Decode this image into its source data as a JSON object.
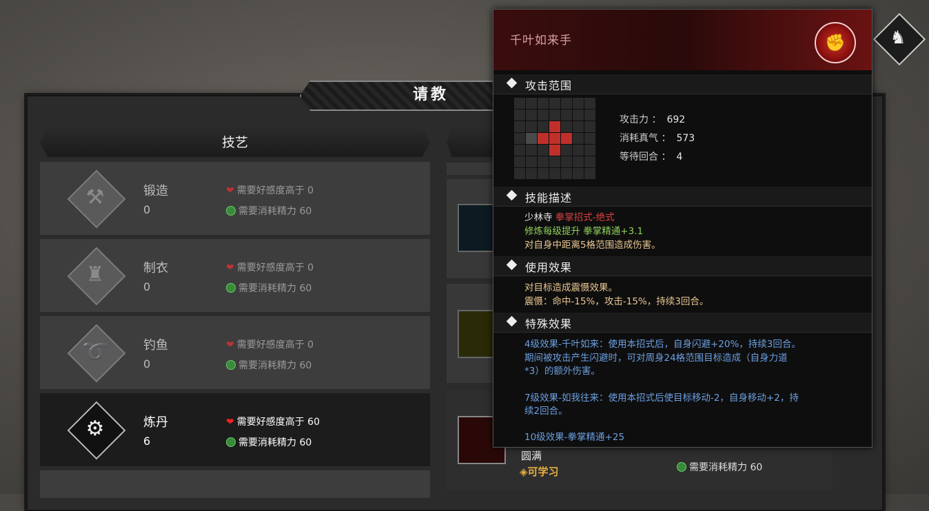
{
  "window": {
    "title": "请教"
  },
  "left_column": {
    "header": "技艺",
    "skills": [
      {
        "name": "锻造",
        "level": "0",
        "req_affinity": "需要好感度高于 0",
        "req_energy": "需要消耗精力 60",
        "icon": "forge-icon",
        "selected": false
      },
      {
        "name": "制衣",
        "level": "0",
        "req_affinity": "需要好感度高于 0",
        "req_energy": "需要消耗精力 60",
        "icon": "tailor-icon",
        "selected": false
      },
      {
        "name": "钓鱼",
        "level": "0",
        "req_affinity": "需要好感度高于 0",
        "req_energy": "需要消耗精力 60",
        "icon": "fishing-icon",
        "selected": false
      },
      {
        "name": "炼丹",
        "level": "6",
        "req_affinity": "需要好感度高于 60",
        "req_energy": "需要消耗精力 60",
        "icon": "alchemy-icon",
        "selected": true
      }
    ]
  },
  "right_column": {
    "bottom_item": {
      "level": "圆满",
      "status": "可学习",
      "req_energy": "需要消耗精力 60"
    }
  },
  "tooltip": {
    "title": "千叶如来手",
    "emblem_icon": "shaolin-fist-icon",
    "sections": {
      "range": "攻击范围",
      "description": "技能描述",
      "usage": "使用效果",
      "special": "特殊效果"
    },
    "range_grid": {
      "size": 7,
      "self": [
        3,
        1
      ],
      "hits": [
        [
          3,
          2
        ],
        [
          4,
          3
        ],
        [
          3,
          3
        ],
        [
          3,
          4
        ],
        [
          2,
          3
        ]
      ]
    },
    "stats": {
      "attack_label": "攻击力 ：",
      "attack": "692",
      "qi_label": "消耗真气 ：",
      "qi": "573",
      "wait_label": "等待回合 ：",
      "wait": "4"
    },
    "desc": {
      "school": "少林寺",
      "type": "拳掌招式-绝式",
      "train": "修炼每级提升 拳掌精通+3.1",
      "effect": "对自身中距离5格范围造成伤害。"
    },
    "usage": {
      "line1": "对目标造成震慑效果。",
      "line2": "震慑：命中-15%，攻击-15%，持续3回合。"
    },
    "special": {
      "l1": "4级效果-千叶如来：使用本招式后，自身闪避+20%，持续3回合。",
      "l2": "期间被攻击产生闪避时，可对周身24格范围目标造成（自身力道",
      "l3": "*3）的额外伤害。",
      "l4": "7级效果-如我往来：使用本招式后使目标移动-2，自身移动+2，持",
      "l5": "续2回合。",
      "l6": "10级效果-拳掌精通+25"
    }
  },
  "colors": {
    "accent_red": "#c0302a",
    "text_blue": "#6c9fe0",
    "text_green": "#8fcf5a",
    "text_gold": "#e8c690"
  }
}
